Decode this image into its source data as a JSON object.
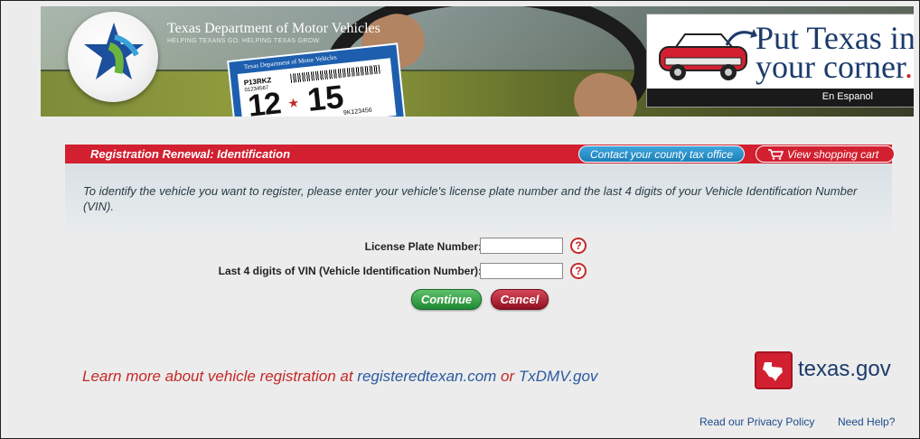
{
  "header": {
    "agency_title": "Texas Department of Motor Vehicles",
    "agency_subtitle": "HELPING TEXANS GO. HELPING TEXAS GROW.",
    "sticker": {
      "header": "Texas Department of Motor Vehicles",
      "plate": "P13RKZ",
      "plate_small": "01234567",
      "month": "12",
      "year": "15",
      "vin": "9K123456"
    },
    "ad": {
      "line1": "Put Texas in",
      "line2": "your corner",
      "period": ".",
      "espanol": "En Espanol"
    }
  },
  "redbar": {
    "title": "Registration Renewal: Identification",
    "county_link": "Contact your county tax office",
    "cart_link": "View shopping cart"
  },
  "info": {
    "text": "To identify the vehicle you want to register, please enter your vehicle's license plate number and the last 4 digits of your Vehicle Identification Number (VIN)."
  },
  "form": {
    "plate_label": "License Plate Number:",
    "plate_value": "",
    "vin_label": "Last 4 digits of VIN (Vehicle Identification Number):",
    "vin_value": "",
    "help_glyph": "?",
    "continue_label": "Continue",
    "cancel_label": "Cancel"
  },
  "footer": {
    "learn_prefix": "Learn more about vehicle registration at ",
    "link1": "registeredtexan.com",
    "or": " or ",
    "link2": "TxDMV.gov",
    "texasgov": "texas.gov",
    "privacy": "Read our Privacy Policy",
    "help": "Need Help?"
  },
  "colors": {
    "red": "#d22030",
    "blue_pill": "#1c7fb8",
    "green_button": "#1f8a34",
    "cancel_button": "#8e1020"
  },
  "icons": [
    "txdmv-star-logo-icon",
    "cart-icon",
    "help-icon",
    "texas-state-icon"
  ]
}
